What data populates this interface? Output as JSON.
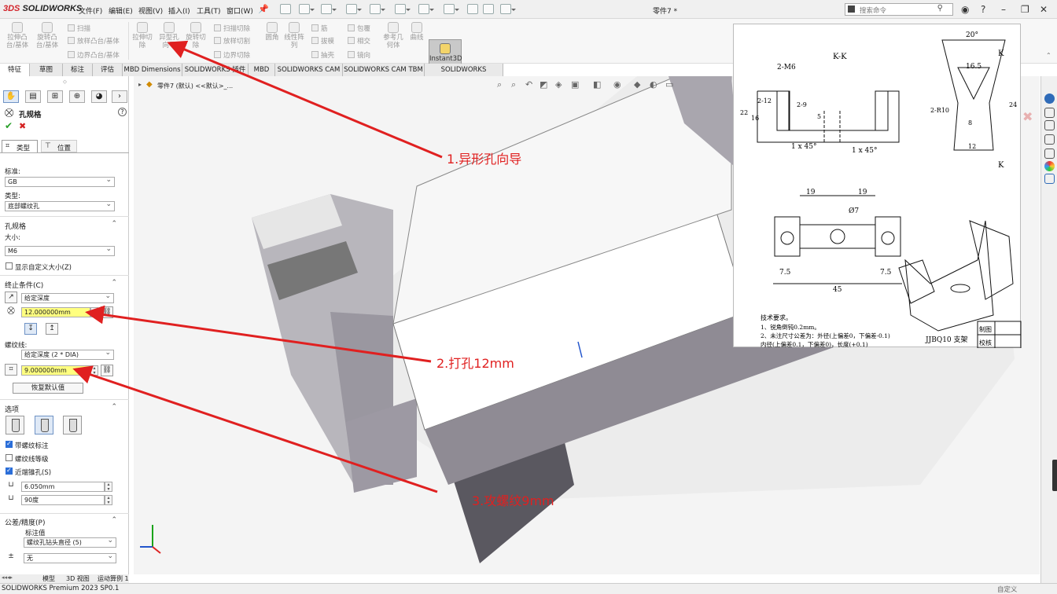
{
  "app": {
    "brand_ds": "3DS",
    "brand": "SOLIDWORKS",
    "doc_title": "零件7 *"
  },
  "menu": [
    "文件(F)",
    "编辑(E)",
    "视图(V)",
    "插入(I)",
    "工具(T)",
    "窗口(W)"
  ],
  "search": {
    "placeholder": "搜索命令"
  },
  "ribbon": {
    "buttons": [
      "拉伸凸台/基体",
      "旋转凸台/基体",
      "拉伸切除",
      "异型孔向导",
      "旋转切除",
      "参考几何体",
      "曲线",
      "Instant3D"
    ],
    "small": [
      "扫描",
      "放样凸台/基体",
      "边界凸台/基体",
      "扫描切除",
      "放样切割",
      "边界切除",
      "圆角",
      "线性阵列",
      "筋",
      "拔模",
      "抽壳",
      "包覆",
      "相交",
      "镜向"
    ]
  },
  "tabs": [
    "特征",
    "草图",
    "标注",
    "评估",
    "MBD Dimensions",
    "SOLIDWORKS 插件",
    "MBD",
    "SOLIDWORKS CAM",
    "SOLIDWORKS CAM TBM",
    "SOLIDWORKS Inspection"
  ],
  "panel": {
    "title": "孔规格",
    "subtabs": [
      "类型",
      "位置"
    ],
    "standard_label": "标准:",
    "standard_value": "GB",
    "type_label": "类型:",
    "type_value": "底部螺纹孔",
    "spec_header": "孔规格",
    "size_label": "大小:",
    "size_value": "M6",
    "custom_size": "显示自定义大小(Z)",
    "end_header": "终止条件(C)",
    "end_value": "给定深度",
    "depth_value": "12.000000mm",
    "thread_label": "螺纹线:",
    "thread_value": "给定深度 (2 * DIA)",
    "thread_depth": "9.000000mm",
    "restore": "恢复默认值",
    "options_header": "选项",
    "opt1": "带螺纹标注",
    "opt2": "螺纹线等级",
    "opt3": "近端锥孔(S)",
    "dia_value": "6.050mm",
    "angle_value": "90度",
    "tol_header": "公差/精度(P)",
    "callout_label": "标注值",
    "callout_value": "螺纹孔钻头直径 (5)",
    "tol_value": "无"
  },
  "tree": {
    "item": "零件7 (默认) <<默认>_..."
  },
  "bottom_tabs": [
    "模型",
    "3D 视图",
    "运动算例 1"
  ],
  "status": {
    "left": "SOLIDWORKS Premium 2023 SP0.1",
    "right": "自定义"
  },
  "annotations": [
    "1.异形孔向导",
    "2.打孔12mm",
    "3.攻螺纹9mm"
  ],
  "drawing": {
    "section": "K-K",
    "dims": [
      "2-M6",
      "2-12",
      "2-9",
      "22",
      "16",
      "5",
      "1 x 45°",
      "1 x 45°",
      "20°",
      "16.5",
      "2-R10",
      "8",
      "12",
      "24",
      "K",
      "K",
      "19",
      "19",
      "Ø7",
      "7.5",
      "7.5",
      "45"
    ],
    "notes_title": "技术要求。",
    "notes": [
      "1、锐角倒钝0.2mm。",
      "2、未注尺寸公差为：外径(上偏差0，下偏差-0.1)",
      "内径(上偏差0.1，下偏差0)，长度(+0.1)"
    ],
    "part_name": "JJBQ10 支架",
    "table": [
      "制图",
      "校核"
    ]
  },
  "colors": {
    "accent": "#e02020",
    "highlight": "#ffff80",
    "model_gray": "#8f8b94"
  }
}
